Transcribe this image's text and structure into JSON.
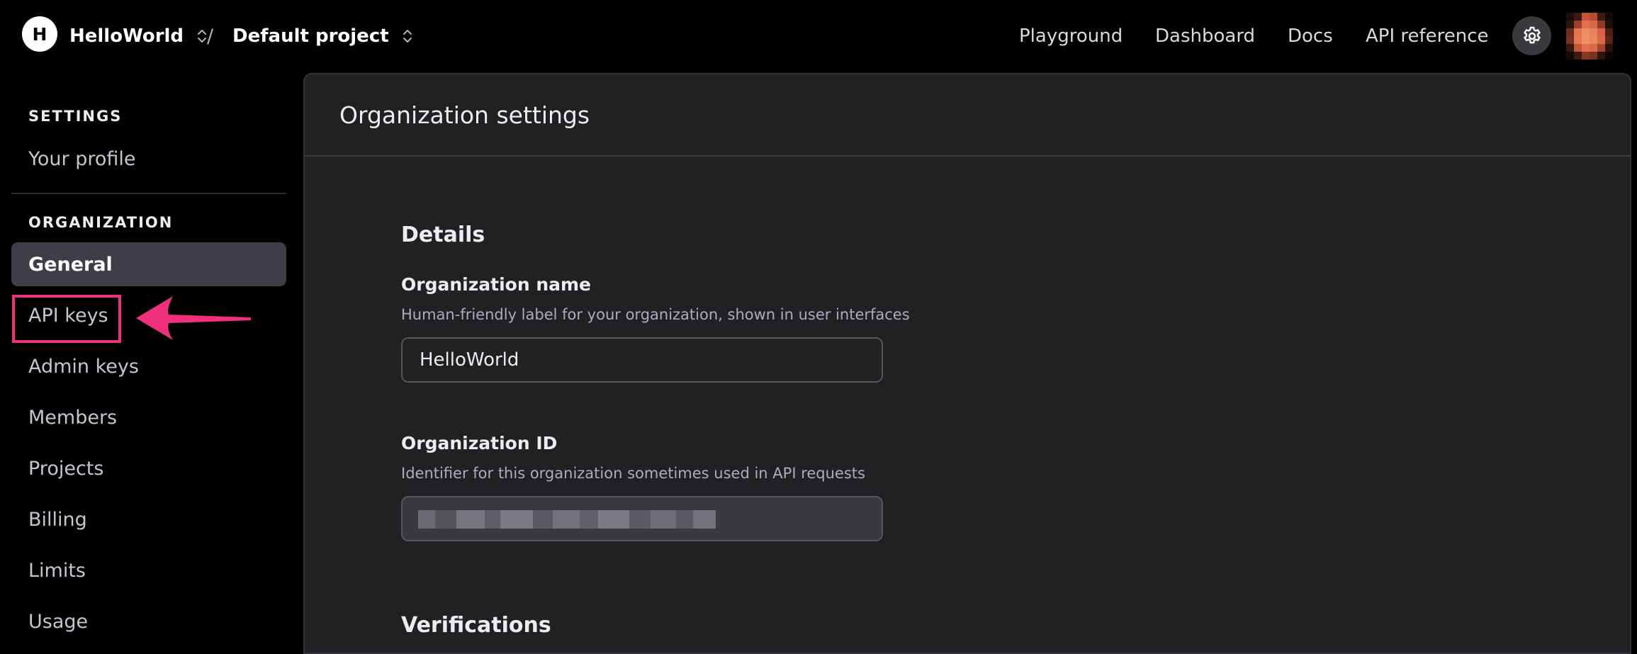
{
  "topbar": {
    "org_initial": "H",
    "org_name": "HelloWorld",
    "separator": "/",
    "project_name": "Default project",
    "nav": [
      "Playground",
      "Dashboard",
      "Docs",
      "API reference"
    ],
    "icons": [
      "chevron-updown-icon",
      "gear-icon",
      "user-avatar"
    ]
  },
  "sidebar": {
    "settings_heading": "SETTINGS",
    "your_profile": "Your profile",
    "organization_heading": "ORGANIZATION",
    "items": [
      "General",
      "API keys",
      "Admin keys",
      "Members",
      "Projects",
      "Billing",
      "Limits",
      "Usage"
    ],
    "active_item": "General",
    "highlighted_item": "API keys",
    "highlight_color": "#f0307a"
  },
  "main": {
    "title": "Organization settings",
    "details_heading": "Details",
    "org_name_label": "Organization name",
    "org_name_desc": "Human-friendly label for your organization, shown in user interfaces",
    "org_name_value": "HelloWorld",
    "org_id_label": "Organization ID",
    "org_id_desc": "Identifier for this organization sometimes used in API requests",
    "verifications_heading": "Verifications"
  },
  "colors": {
    "background": "#000000",
    "panel": "#202123",
    "active_item": "#3e3f46",
    "accent_annotation": "#f0307a"
  }
}
